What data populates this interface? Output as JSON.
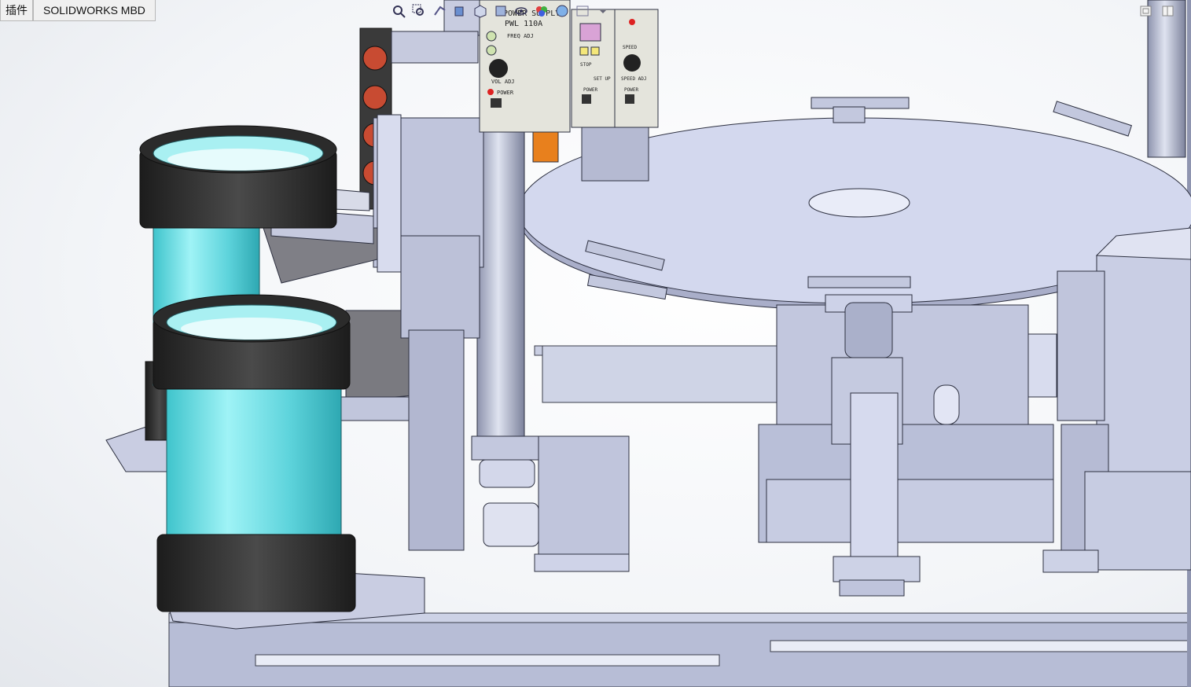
{
  "tabs": [
    {
      "label": "插件"
    },
    {
      "label": "SOLIDWORKS MBD"
    }
  ],
  "view_toolbar": {
    "icons": [
      "zoom-to-fit-icon",
      "zoom-to-area-icon",
      "previous-view-icon",
      "section-view-icon",
      "view-orientation-icon",
      "display-style-icon",
      "hide-show-items-icon",
      "edit-appearance-icon",
      "apply-scene-icon",
      "view-settings-icon",
      "toolbar-dropdown-icon"
    ]
  },
  "window_controls": {
    "icons": [
      "restore-pane-icon",
      "maximize-pane-icon"
    ]
  },
  "model": {
    "panel_main": {
      "title": "POWER SUPPLY",
      "model": "PWL 110A",
      "labels": [
        "FREQ ADJ",
        "VOL ADJ",
        "POWER"
      ]
    },
    "panel_mid": {
      "labels": [
        "STOP",
        "SET UP",
        "POWER"
      ]
    },
    "panel_right": {
      "labels": [
        "SPEED",
        "SPEED ADJ",
        "POWER"
      ]
    },
    "colors": {
      "bowl_cyan": "#5fd6de",
      "bowl_ring": "#2b2b2b",
      "machine_body": "#b9bfd6",
      "panel": "#e4e4dc",
      "signal_red": "#c84b32",
      "orange_part": "#e8801d"
    }
  }
}
